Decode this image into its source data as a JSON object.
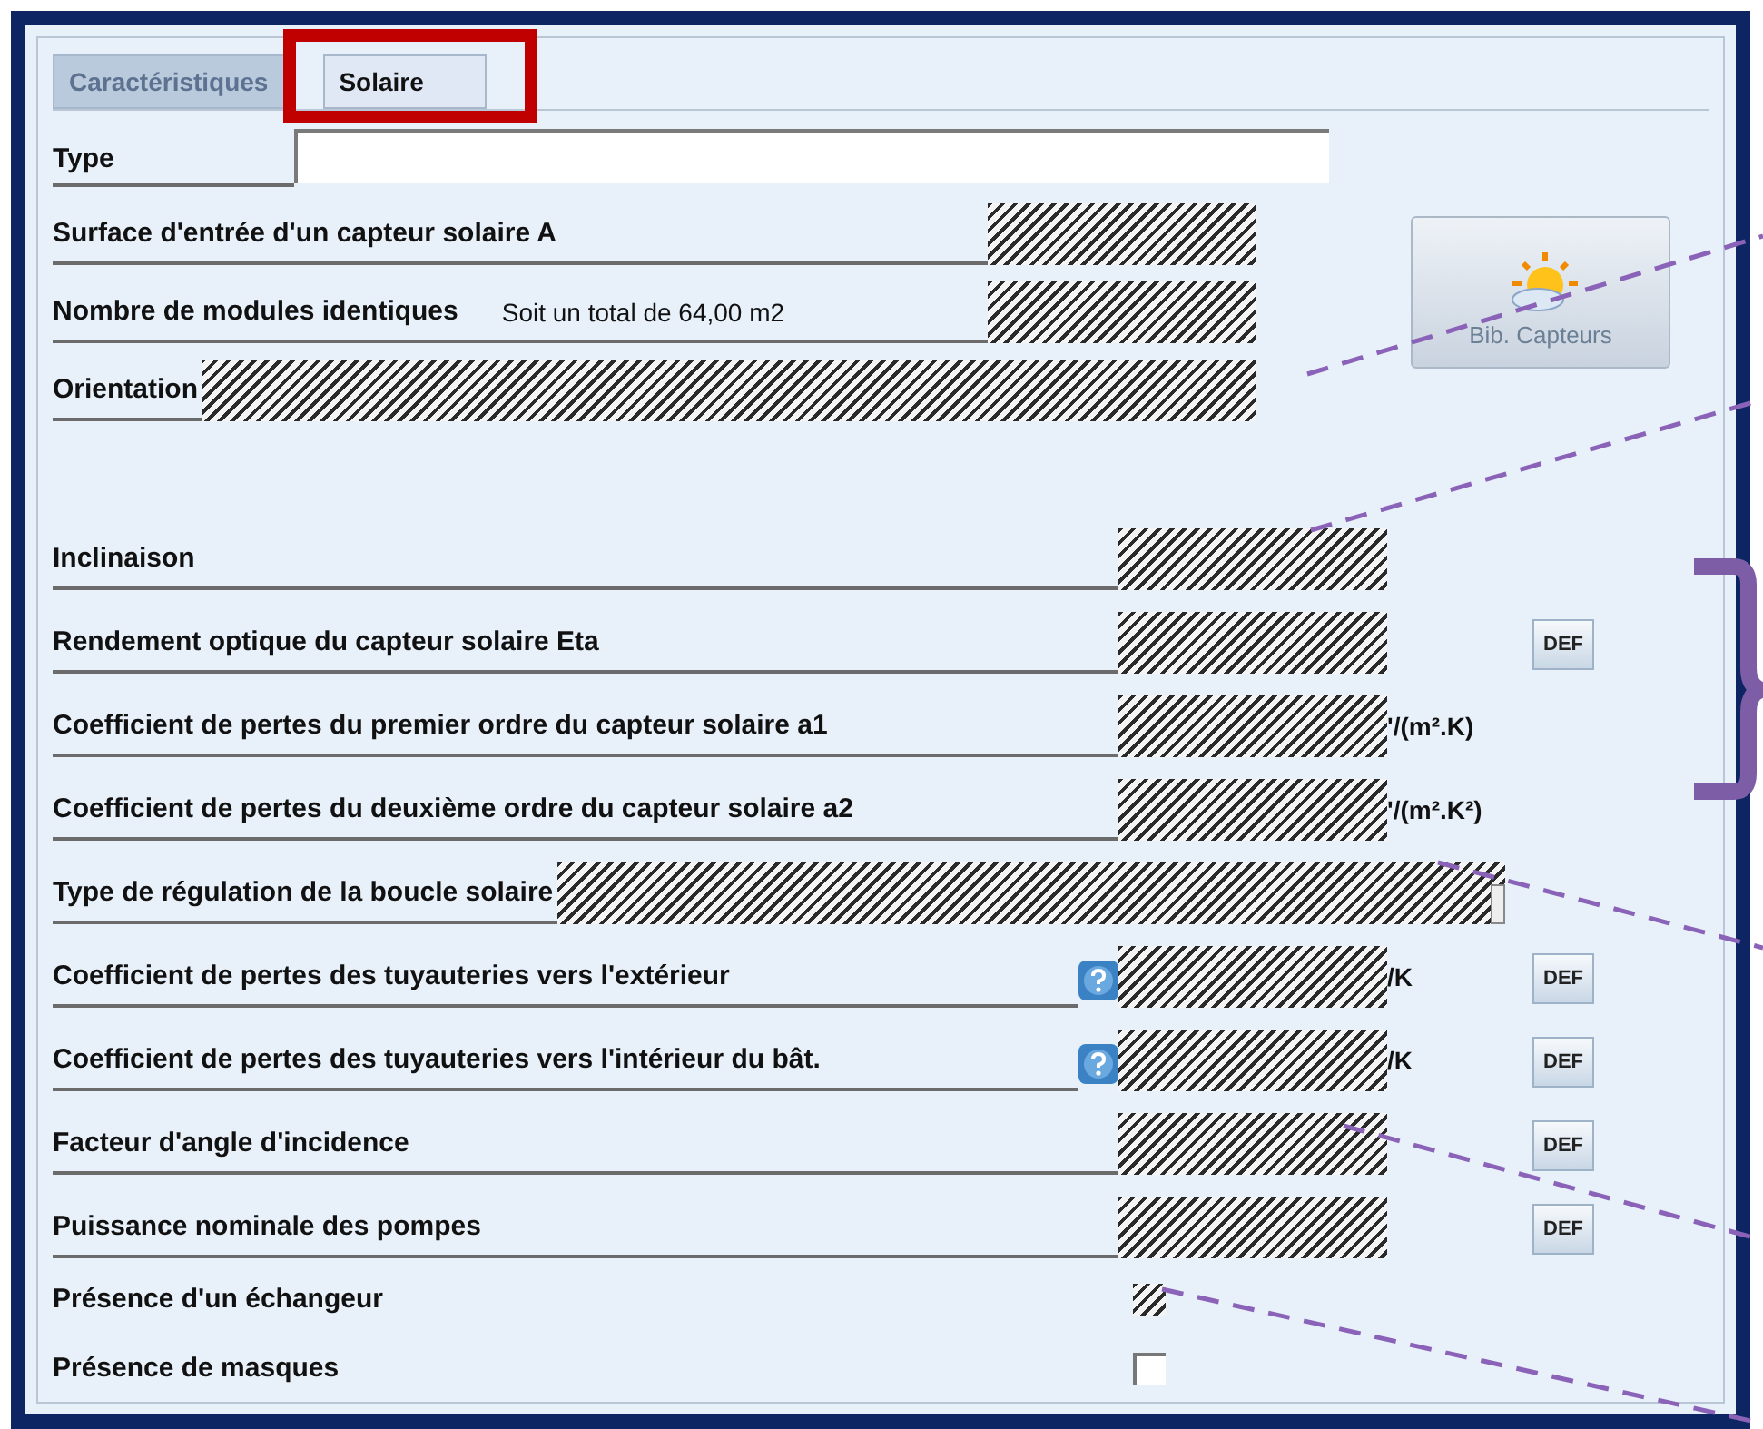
{
  "tabs": [
    {
      "label": "Caractéristiques",
      "selected": false
    },
    {
      "label": "Solaire",
      "selected": true
    }
  ],
  "type_field": {
    "label": "Type"
  },
  "library_button": {
    "label": "Bib. Capteurs"
  },
  "top_rows": [
    {
      "label": "Surface d'entrée d'un capteur solaire  A",
      "kind": "short"
    },
    {
      "label": "Nombre de modules identiques",
      "note": "Soit un total de 64,00 m2",
      "kind": "short"
    },
    {
      "label": "Orientation",
      "kind": "wide"
    }
  ],
  "rows": [
    {
      "label": "Inclinaison",
      "kind": "short"
    },
    {
      "label": "Rendement optique du capteur solaire  Eta",
      "kind": "short",
      "def": "DEF"
    },
    {
      "label": "Coefficient de pertes du premier ordre du capteur solaire a1",
      "kind": "short",
      "unit": "'/(m².K)"
    },
    {
      "label": "Coefficient de pertes du deuxième ordre du capteur solaire a2",
      "kind": "short",
      "unit": "'/(m².K²)"
    },
    {
      "label": "Type de régulation de la boucle solaire",
      "kind": "combo"
    },
    {
      "label": "Coefficient de pertes des tuyauteries vers l'extérieur",
      "kind": "short",
      "help": true,
      "unit": "/K",
      "def": "DEF"
    },
    {
      "label": "Coefficient de pertes des tuyauteries vers l'intérieur du bât.",
      "kind": "short",
      "help": true,
      "unit": "/K",
      "def": "DEF"
    },
    {
      "label": "Facteur d'angle d'incidence",
      "kind": "short",
      "def": "DEF"
    },
    {
      "label": "Puissance nominale des pompes",
      "kind": "short",
      "def": "DEF"
    }
  ],
  "checkboxes": [
    {
      "label": "Présence d'un échangeur",
      "checked": false,
      "disabled": true
    },
    {
      "label": "Présence de masques",
      "checked": false,
      "disabled": false
    }
  ]
}
